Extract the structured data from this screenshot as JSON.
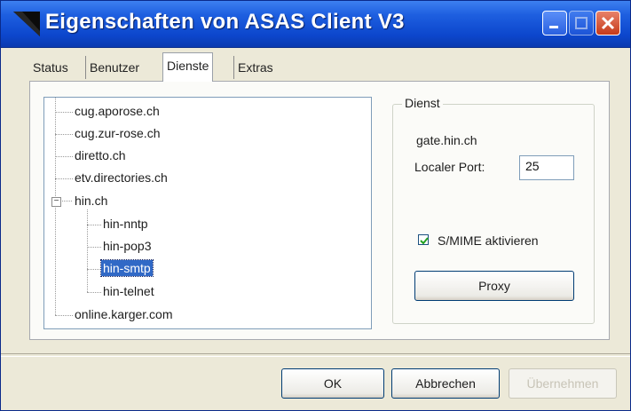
{
  "window": {
    "title": "Eigenschaften von ASAS Client V3"
  },
  "tabs": [
    {
      "label": "Status",
      "active": false
    },
    {
      "label": "Benutzer",
      "active": false
    },
    {
      "label": "Dienste",
      "active": true
    },
    {
      "label": "Extras",
      "active": false
    }
  ],
  "tree": {
    "items": [
      {
        "label": "cug.aporose.ch",
        "level": 0
      },
      {
        "label": "cug.zur-rose.ch",
        "level": 0
      },
      {
        "label": "diretto.ch",
        "level": 0
      },
      {
        "label": "etv.directories.ch",
        "level": 0
      },
      {
        "label": "hin.ch",
        "level": 0,
        "expanded": true
      },
      {
        "label": "hin-nntp",
        "level": 1
      },
      {
        "label": "hin-pop3",
        "level": 1
      },
      {
        "label": "hin-smtp",
        "level": 1,
        "selected": true
      },
      {
        "label": "hin-telnet",
        "level": 1
      },
      {
        "label": "online.karger.com",
        "level": 0
      }
    ]
  },
  "dienst": {
    "legend": "Dienst",
    "host": "gate.hin.ch",
    "port_label": "Localer Port:",
    "port_value": "25",
    "smime_label": "S/MIME aktivieren",
    "smime_checked": true,
    "proxy_button": "Proxy"
  },
  "footer": {
    "ok": "OK",
    "cancel": "Abbrechen",
    "apply": "Übernehmen"
  },
  "colors": {
    "titlebar": "#0c46cc",
    "selection": "#3169c6",
    "close_button": "#c63a1a"
  }
}
